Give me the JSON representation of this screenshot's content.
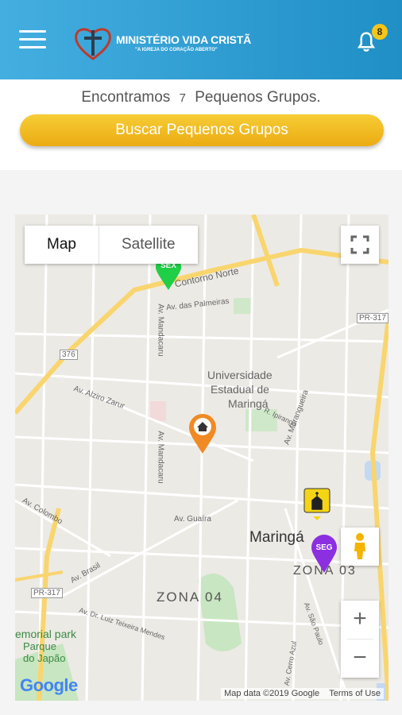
{
  "header": {
    "app_name": "MINISTÉRIO VIDA CRISTÃ",
    "tagline": "\"A IGREJA DO CORAÇÃO ABERTO\"",
    "notification_count": "8"
  },
  "results": {
    "prefix": "Encontramos",
    "count": "7",
    "suffix": "Pequenos Grupos."
  },
  "search_button": "Buscar Pequenos Grupos",
  "map": {
    "type_map": "Map",
    "type_satellite": "Satellite",
    "labels": {
      "contorno_norte": "Contorno Norte",
      "palmeiras": "Av. das Palmeiras",
      "route376": "376",
      "pr317_top": "PR-317",
      "universidade": "Universidade",
      "estadual": "Estadual de",
      "maringa_uni": "Maringá",
      "alziro": "Av. Alziro Zarur",
      "mandacaru": "Av. Mandacaru",
      "mandacaru2": "Av. Mandacaru",
      "guaira": "Av. Guaíra",
      "maringa": "Maringá",
      "zona03": "ZONA 03",
      "zona04": "ZONA 04",
      "brasil": "Av. Brasil",
      "colombo": "Av. Colombo",
      "pr317_bottom": "PR-317",
      "memorial_park": "emorial park",
      "parque": "Parque",
      "japao": "do Japão",
      "luiz": "Av. Dr. Luiz Teixeira Mendes",
      "sao_paulo": "Av. São Paulo",
      "cerro": "Av. Cerro Azul",
      "morangueira": "Av. Morangueira",
      "ipiranga": "R. Ipiranga"
    },
    "markers": {
      "sex": "SEX",
      "seg": "SEG"
    },
    "google": "Google",
    "attribution": "Map data ©2019 Google",
    "terms": "Terms of Use",
    "zoom_in": "+",
    "zoom_out": "−"
  }
}
